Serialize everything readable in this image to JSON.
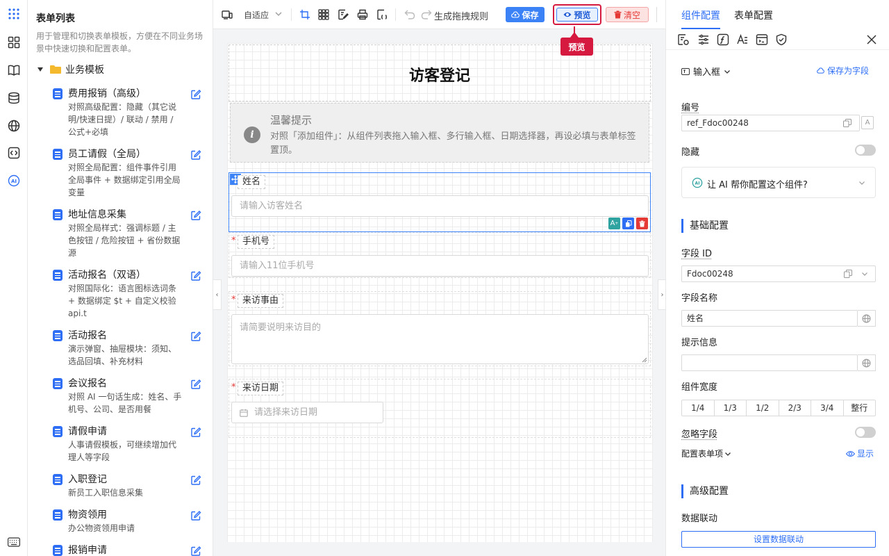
{
  "template_panel": {
    "title": "表单列表",
    "description": "用于管理和切换表单模板，方便在不同业务场景中快速切换和配置表单。",
    "folder": "业务模板",
    "items": [
      {
        "name": "费用报销（高级）",
        "desc": "对照高级配置：隐藏（其它说明/快速日提）/ 联动 / 禁用 / 公式+必填"
      },
      {
        "name": "员工请假（全局）",
        "desc": "对照全局配置：组件事件引用全局事件 + 数据绑定引用全局变量"
      },
      {
        "name": "地址信息采集",
        "desc": "对照全局样式：强调标题 / 主色按钮 / 危险按钮 + 省份数据源"
      },
      {
        "name": "活动报名（双语）",
        "desc": "对照国际化：语言图标选词条 + 数据绑定 $t + 自定义校验 api.t"
      },
      {
        "name": "活动报名",
        "desc": "演示弹窗、抽屉模块：须知、选品回填、补充材料"
      },
      {
        "name": "会议报名",
        "desc": "对照 AI 一句话生成：姓名、手机号、公司、是否用餐"
      },
      {
        "name": "请假申请",
        "desc": "人事请假模板，可继续增加代理人等字段"
      },
      {
        "name": "入职登记",
        "desc": "新员工入职信息采集"
      },
      {
        "name": "物资领用",
        "desc": "办公物资领用申请"
      },
      {
        "name": "报销申请",
        "desc": ""
      }
    ]
  },
  "toolbar": {
    "zoom": "自适应",
    "rules": "生成拖拽规则",
    "save": "保存",
    "preview": "预览",
    "clear": "清空",
    "tooltip": "预览"
  },
  "form": {
    "title": "访客登记",
    "tip_title": "温馨提示",
    "tip_text": "对照「添加组件」：从组件列表拖入输入框、多行输入框、日期选择器，再设必填与表单标签置顶。",
    "fields": [
      {
        "label": "姓名",
        "placeholder": "请输入访客姓名",
        "required": false
      },
      {
        "label": "手机号",
        "placeholder": "请输入11位手机号",
        "required": true
      },
      {
        "label": "来访事由",
        "placeholder": "请简要说明来访目的",
        "required": true
      },
      {
        "label": "来访日期",
        "placeholder": "请选择来访日期",
        "required": true
      }
    ],
    "required_mark": "*"
  },
  "config": {
    "tab_component": "组件配置",
    "tab_form": "表单配置",
    "component_type": "输入框",
    "save_as_field": "保存为字段",
    "ref_label": "编号",
    "ref_value": "ref_Fdoc00248",
    "hidden_label": "隐藏",
    "ai_prompt": "让 AI 帮你配置这个组件?",
    "basic_title": "基础配置",
    "field_id_label": "字段 ID",
    "field_id_value": "Fdoc00248",
    "field_name_label": "字段名称",
    "field_name_value": "姓名",
    "hint_label": "提示信息",
    "hint_value": "",
    "width_label": "组件宽度",
    "widths": [
      "1/4",
      "1/3",
      "1/2",
      "2/3",
      "3/4",
      "整行"
    ],
    "ignore_label": "忽略字段",
    "form_item_label": "配置表单项",
    "show_label": "显示",
    "advanced_title": "高级配置",
    "linkage_label": "数据联动",
    "linkage_button": "设置数据联动"
  },
  "colors": {
    "accent": "#2d6ef5",
    "danger": "#d6193f"
  }
}
